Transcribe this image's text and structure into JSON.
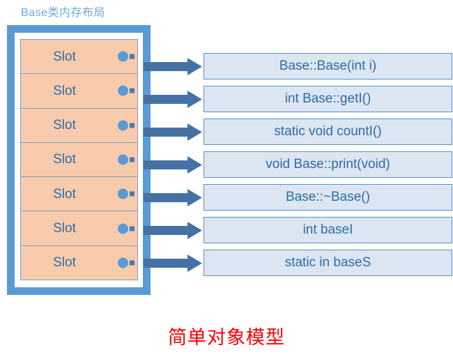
{
  "title": "Base类内存布局",
  "caption": "简单对象模型",
  "colors": {
    "container_border": "#5B9BD5",
    "slot_fill": "#F8CBAD",
    "slot_text": "#2E6DA4",
    "box_fill": "#DCE6F2",
    "box_border": "#5B8FC0",
    "arrow": "#4472A4",
    "dot": "#5B9BD5",
    "title_text": "#6FA8DC",
    "caption_text": "#FF0000"
  },
  "slots": [
    {
      "label": "Slot"
    },
    {
      "label": "Slot"
    },
    {
      "label": "Slot"
    },
    {
      "label": "Slot"
    },
    {
      "label": "Slot"
    },
    {
      "label": "Slot"
    },
    {
      "label": "Slot"
    }
  ],
  "members": [
    {
      "label": "Base::Base(int i)"
    },
    {
      "label": "int Base::getI()"
    },
    {
      "label": "static void countI()"
    },
    {
      "label": "void Base::print(void)"
    },
    {
      "label": "Base::~Base()"
    },
    {
      "label": "int baseI"
    },
    {
      "label": "static in baseS"
    }
  ]
}
